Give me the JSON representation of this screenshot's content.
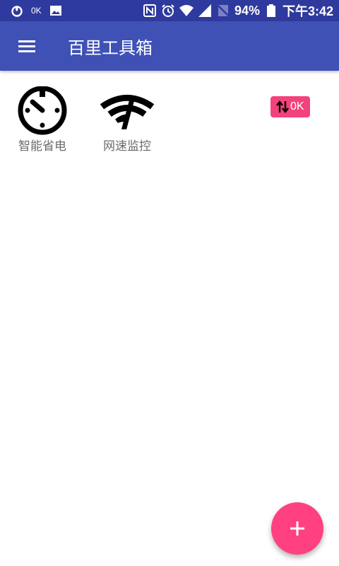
{
  "status_bar": {
    "left_badge": "0K",
    "battery_percent": "94%",
    "time": "下午3:42",
    "icons": [
      "netease-icon",
      "image-icon",
      "nfc-icon",
      "alarm-icon",
      "wifi-icon",
      "signal-icon",
      "no-sim-icon",
      "battery-icon"
    ]
  },
  "app_bar": {
    "title": "百里工具箱",
    "menu_icon": "menu-icon"
  },
  "tiles": [
    {
      "label": "智能省电",
      "icon": "timer-circle-icon"
    },
    {
      "label": "网速监控",
      "icon": "wifi-speed-icon"
    }
  ],
  "speed_badge": {
    "value": "0K",
    "icon": "swap-vertical-icon",
    "color": "#f2437c"
  },
  "fab": {
    "icon": "add-icon",
    "color": "#ff4081"
  },
  "colors": {
    "status_bar": "#2f3a9e",
    "app_bar": "#3f51b5",
    "label_gray": "#6b6b6b"
  }
}
